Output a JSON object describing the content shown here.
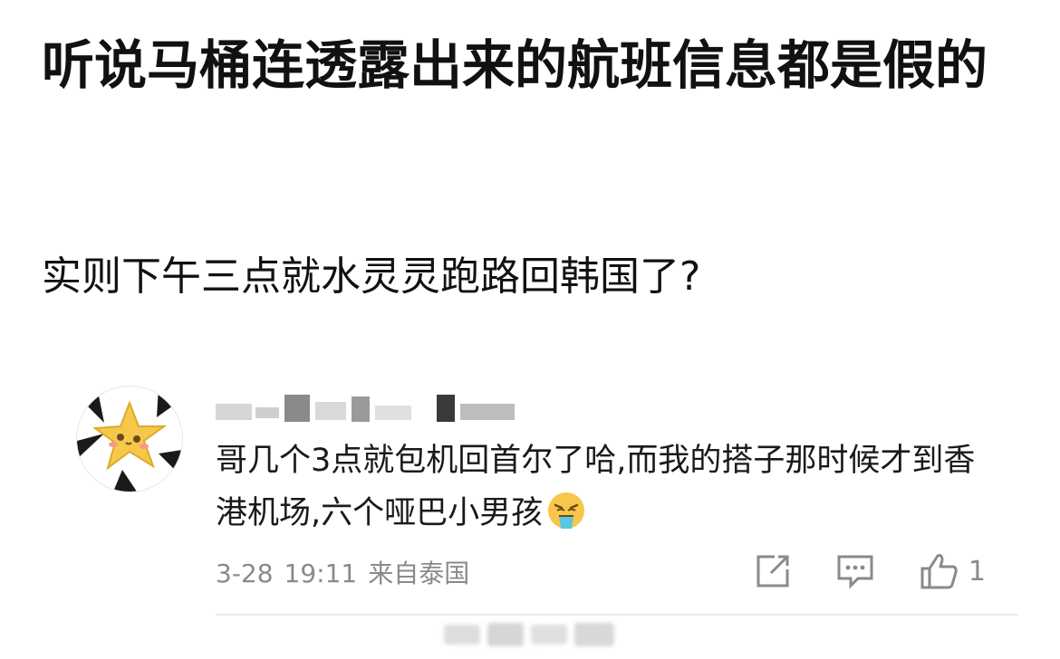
{
  "post": {
    "title": "听说马桶连透露出来的航班信息都是假的",
    "body": "实则下午三点就水灵灵跑路回韩国了?"
  },
  "comment": {
    "username": "",
    "text": "哥几个3点就包机回首尔了哈,而我的搭子那时候才到香港机场,六个哑巴小男孩",
    "emoji": "vomit-face-emoji",
    "date": "3-28",
    "time": "19:11",
    "source": "来自泰国",
    "like_count": "1",
    "actions": [
      "share-icon",
      "comment-icon",
      "like-icon"
    ]
  },
  "colors": {
    "text": "#111111",
    "meta": "#8a8a8a",
    "avatar_star": "#f5c84a",
    "divider": "#ececec"
  }
}
